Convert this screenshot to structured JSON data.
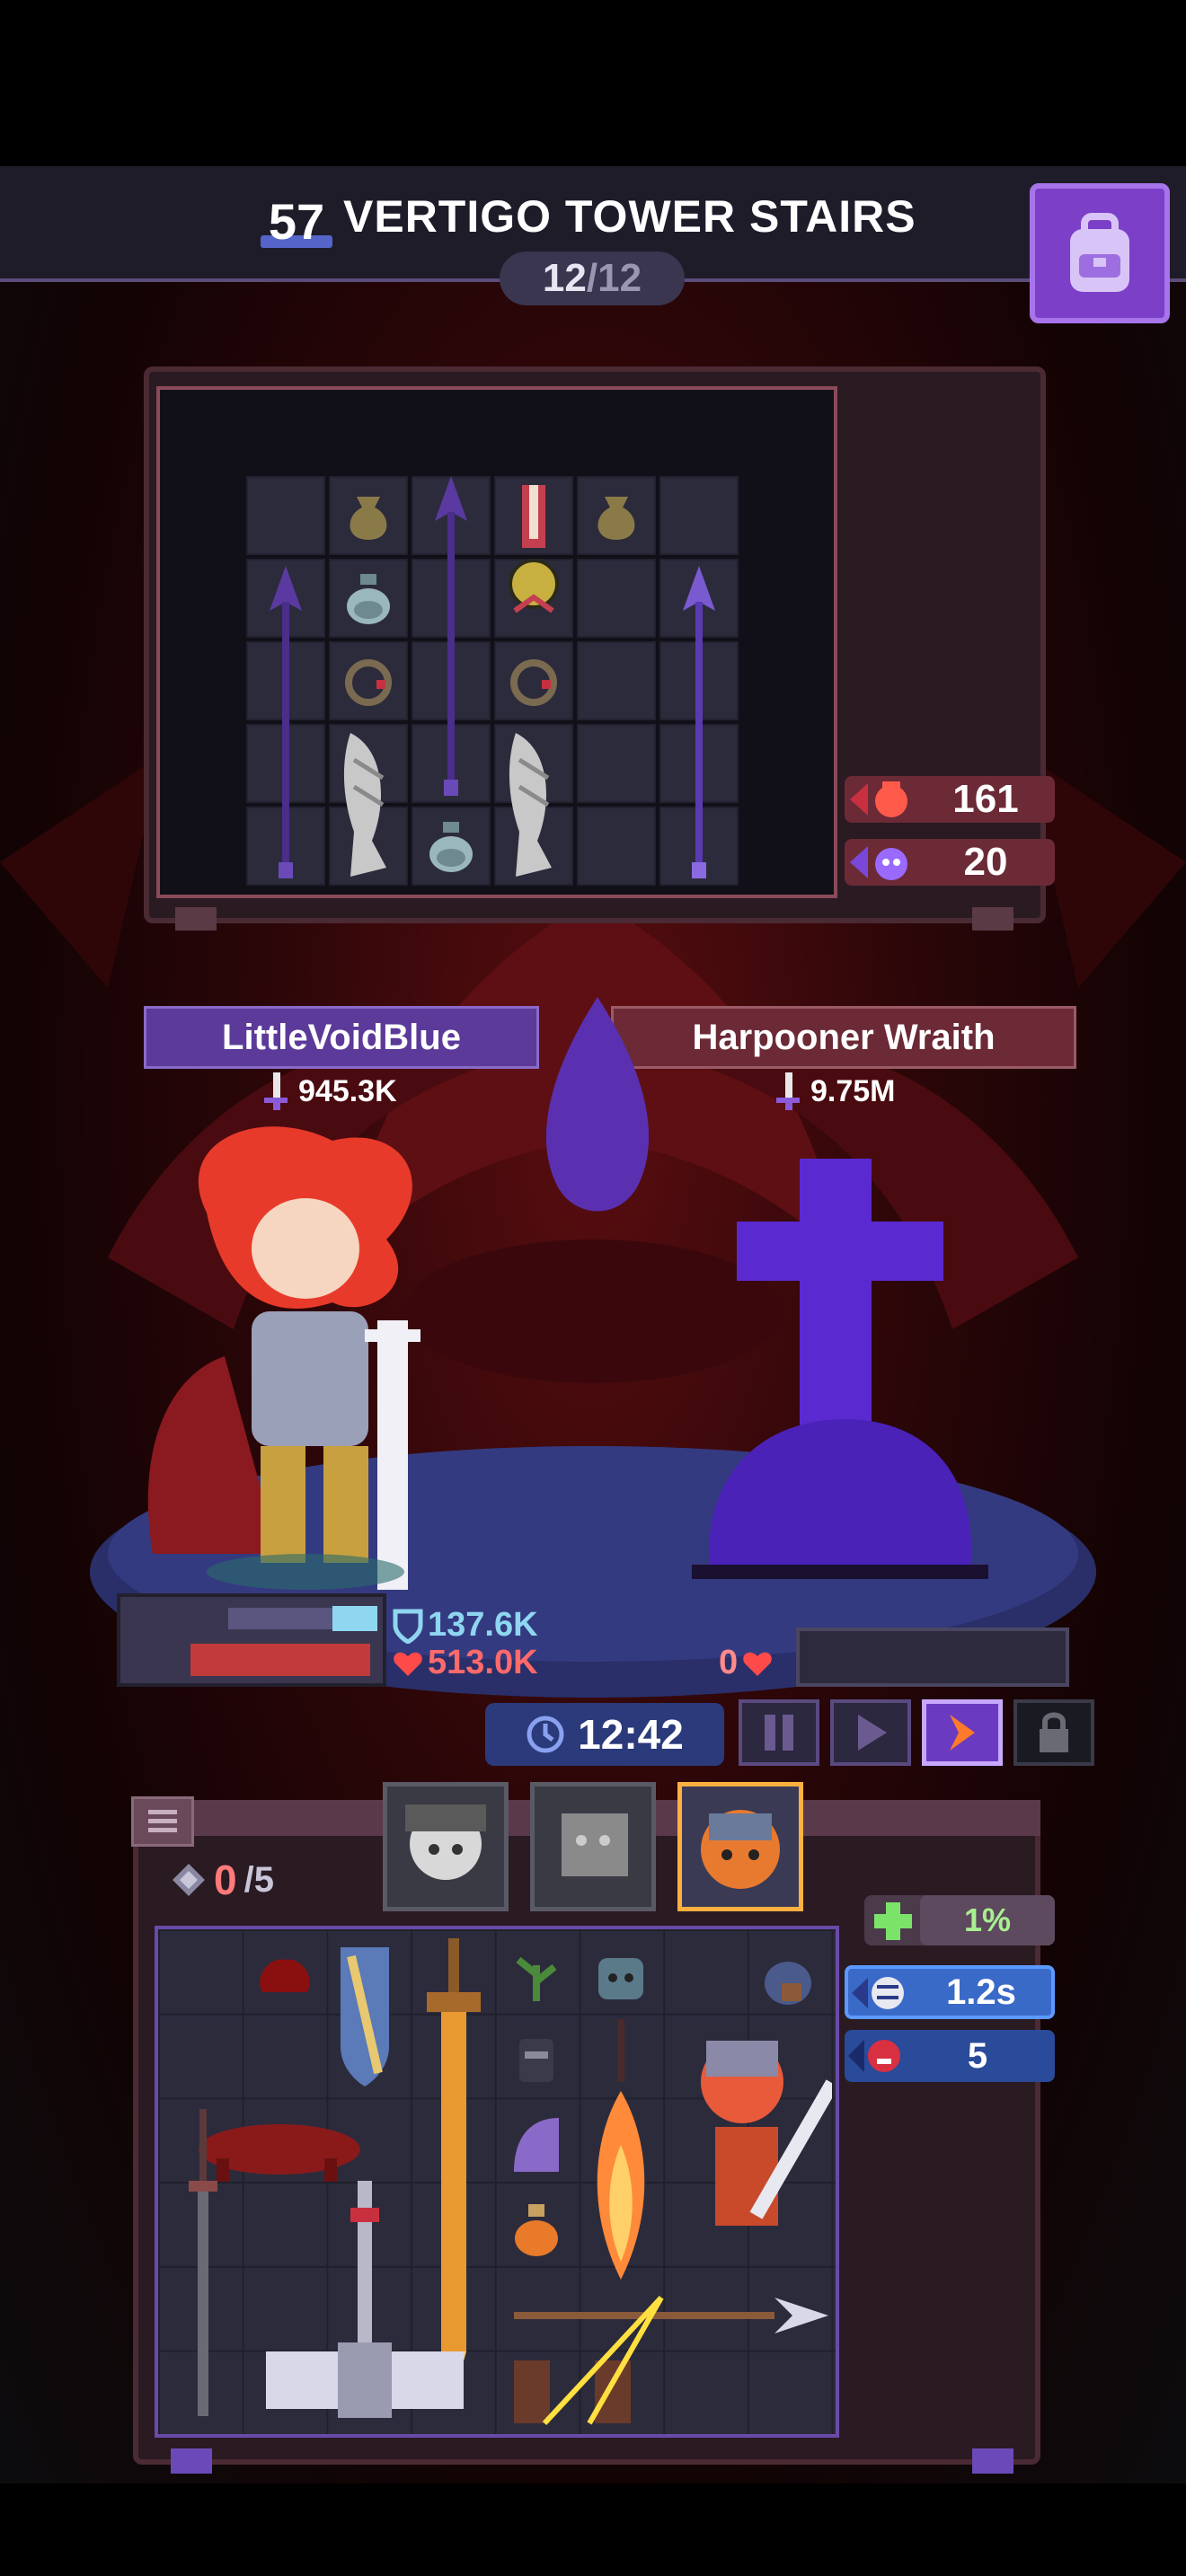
{
  "stage": {
    "floor_number": "57",
    "title": "VERTIGO TOWER STAIRS",
    "progress_current": "12",
    "progress_separator": "/",
    "progress_total": "12"
  },
  "enemy_counters": {
    "hits": "161",
    "monsters": "20"
  },
  "player": {
    "name": "LittleVoidBlue",
    "power": "945.3K",
    "shield": "137.6K",
    "hp": "513.0K"
  },
  "enemy": {
    "name": "Harpooner Wraith",
    "power": "9.75M",
    "hp": "0"
  },
  "timer": "12:42",
  "inventory": {
    "slots_used": "0",
    "slots_total": "/5"
  },
  "stats": {
    "heal": "1%",
    "speed": "1.2s",
    "rage": "5"
  },
  "colors": {
    "accent_purple": "#6a3fb0",
    "enemy_red": "#6b2a36",
    "shield_cyan": "#8fd6f0",
    "hp_red": "#ff4a4a",
    "heal_green": "#7ce36a"
  }
}
